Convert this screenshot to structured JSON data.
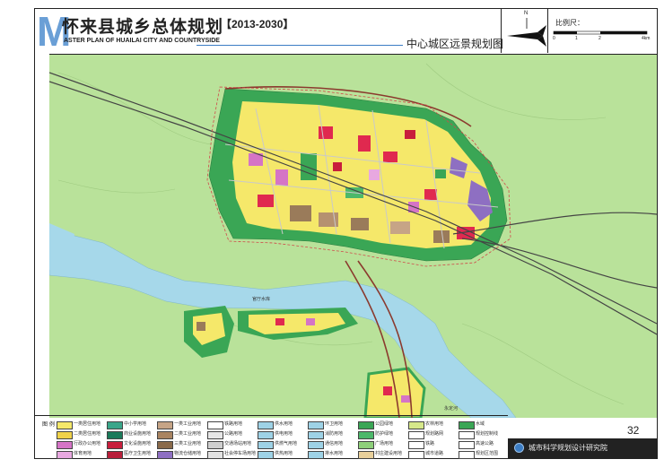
{
  "header": {
    "big_letter": "M",
    "title_cn": "怀来县城乡总体规划",
    "years": "【2013-2030】",
    "title_en": "ASTER PLAN OF HUAILAI CITY AND COUNTRYSIDE",
    "map_name": "中心城区远景规划图"
  },
  "north": {
    "label": "N"
  },
  "scale": {
    "label": "比例尺：",
    "ticks": [
      "0",
      "1",
      "2",
      "4km"
    ]
  },
  "map": {
    "water_label_west": "官厅水库",
    "water_label_south": "永定河",
    "colors": {
      "background": "#b9e29a",
      "water": "#a6d8ea",
      "park_green": "#3aa655",
      "residential": "#f5e86a",
      "commercial": "#e0294f",
      "education": "#d574c6",
      "industry": "#9a7b5a",
      "logistics": "#8e6fc2",
      "road": "#c0c0c0",
      "rail": "#444444",
      "highway": "#8b3a2e"
    }
  },
  "legend": {
    "title": "图 例",
    "items": [
      {
        "label": "一类居住用地",
        "color": "#f5e86a"
      },
      {
        "label": "中小学用地",
        "color": "#3aa68a"
      },
      {
        "label": "一类工业用地",
        "color": "#c6a486"
      },
      {
        "label": "铁路用地",
        "color": "#ffffff"
      },
      {
        "label": "供水用地",
        "color": "#9ed2e6"
      },
      {
        "label": "环卫用地",
        "color": "#9ed2e6"
      },
      {
        "label": "公园绿地",
        "color": "#3aa655"
      },
      {
        "label": "农林用地",
        "color": "#d6e88a"
      },
      {
        "label": "水域",
        "color": "#3aa655"
      },
      {
        "label": "二类居住用地",
        "color": "#f0d24a"
      },
      {
        "label": "商业设施用地",
        "color": "#1a7a5a"
      },
      {
        "label": "二类工业用地",
        "color": "#a98461"
      },
      {
        "label": "公路用地",
        "color": "#e6e6e6"
      },
      {
        "label": "供电用地",
        "color": "#9ed2e6"
      },
      {
        "label": "消防用地",
        "color": "#9ed2e6"
      },
      {
        "label": "防护绿地",
        "color": "#4cb86a"
      },
      {
        "label": "规划路网",
        "color": "#ffffff"
      },
      {
        "label": "规划控制线",
        "color": "#ffffff"
      },
      {
        "label": "行政办公用地",
        "color": "#d574c6"
      },
      {
        "label": "文化设施用地",
        "color": "#c81e3c"
      },
      {
        "label": "三类工业用地",
        "color": "#8a6a4a"
      },
      {
        "label": "交通场站用地",
        "color": "#cfcfcf"
      },
      {
        "label": "供燃气用地",
        "color": "#9ed2e6"
      },
      {
        "label": "通信用地",
        "color": "#9ed2e6"
      },
      {
        "label": "广场用地",
        "color": "#8ed07a"
      },
      {
        "label": "铁路",
        "color": "#ffffff"
      },
      {
        "label": "高速公路",
        "color": "#ffffff"
      },
      {
        "label": "体育用地",
        "color": "#e8a8e0"
      },
      {
        "label": "医疗卫生用地",
        "color": "#b81e3a"
      },
      {
        "label": "物流仓储用地",
        "color": "#8e6fc2"
      },
      {
        "label": "社会停车场用地",
        "color": "#e2e2e2"
      },
      {
        "label": "供热用地",
        "color": "#9ed2e6"
      },
      {
        "label": "排水用地",
        "color": "#9ed2e6"
      },
      {
        "label": "村庄建设用地",
        "color": "#e8cf9a"
      },
      {
        "label": "城市道路",
        "color": "#ffffff"
      },
      {
        "label": "规划区范围",
        "color": "#ffffff"
      }
    ]
  },
  "page_number": "32",
  "org": "城市科学规划设计研究院"
}
